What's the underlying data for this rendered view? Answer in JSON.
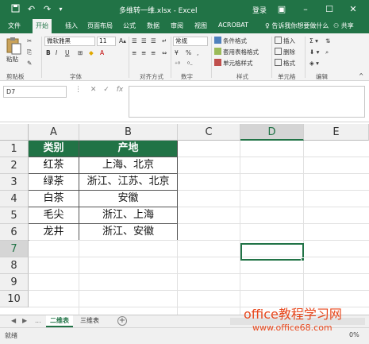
{
  "colors": {
    "brand": "#217346",
    "watermark": "#e8471c"
  },
  "titlebar": {
    "title": "多维转一维.xlsx - Excel",
    "login": "登录",
    "icons": [
      "save-icon",
      "undo-icon",
      "redo-icon",
      "customize-icon"
    ],
    "window_buttons": [
      "ribbon-display-icon",
      "minimize-icon",
      "maximize-icon",
      "close-icon"
    ]
  },
  "tabs": [
    "文件",
    "开始",
    "插入",
    "页面布局",
    "公式",
    "数据",
    "审阅",
    "视图",
    "ACROBAT"
  ],
  "active_tab": "开始",
  "tell_me": "告诉我你想要做什么",
  "share": "共享",
  "ribbon": {
    "paste": "粘贴",
    "font_name": "微软雅黑",
    "font_size": "11",
    "number_format": "常规",
    "groups": [
      "剪贴板",
      "字体",
      "对齐方式",
      "数字",
      "样式",
      "单元格",
      "编辑"
    ],
    "style_items": [
      "条件格式",
      "套用表格格式",
      "单元格样式"
    ],
    "cell_items": [
      "插入",
      "删除",
      "格式"
    ],
    "font_buttons": [
      "B",
      "I",
      "U"
    ],
    "number_buttons": [
      "%",
      ","
    ]
  },
  "formula_bar": {
    "name_box": "D7",
    "formula": ""
  },
  "grid": {
    "columns": [
      "A",
      "B",
      "C",
      "D",
      "E"
    ],
    "rows": [
      "1",
      "2",
      "3",
      "4",
      "5",
      "6",
      "7",
      "8",
      "9",
      "10"
    ],
    "selected_column": "D",
    "selected_row": "7",
    "table_header": [
      "类别",
      "产地"
    ],
    "table_rows": [
      [
        "红茶",
        "上海、北京"
      ],
      [
        "绿茶",
        "浙江、江苏、北京"
      ],
      [
        "白茶",
        "安徽"
      ],
      [
        "毛尖",
        "浙江、上海"
      ],
      [
        "龙井",
        "浙江、安徽"
      ]
    ]
  },
  "sheets": [
    "二维表",
    "三维表"
  ],
  "active_sheet": "二维表",
  "sheet_nav": [
    "◀",
    "▶",
    "..."
  ],
  "status": {
    "text": "就绪",
    "zoom": "0%"
  },
  "watermark": {
    "line1": "office教程学习网",
    "line2": "www.office68.com"
  }
}
